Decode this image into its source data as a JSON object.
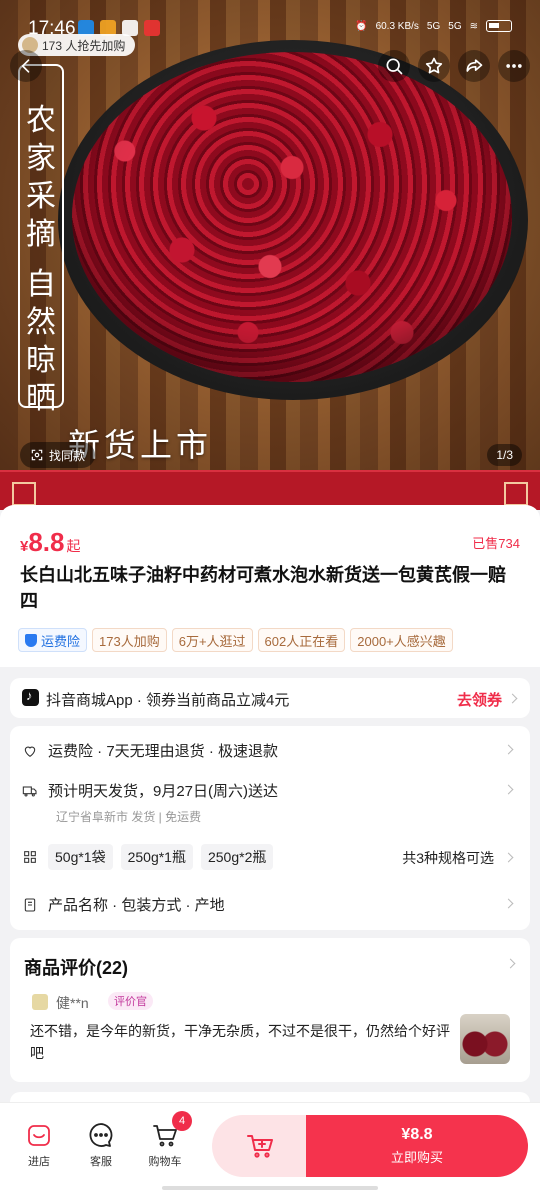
{
  "status_bar": {
    "time": "17:46",
    "network_speed": "60.3 KB/s",
    "signal_1": "5G",
    "signal_2": "5G"
  },
  "hero": {
    "buyers_text": "173 人抢先加购",
    "banner_line_1": [
      "农",
      "家",
      "采",
      "摘"
    ],
    "banner_line_2": [
      "自",
      "然",
      "晾",
      "晒"
    ],
    "overlay_text": "新货上市",
    "find_similar": "找同款",
    "page_indicator": "1/3"
  },
  "product": {
    "currency": "¥",
    "price": "8.8",
    "price_suffix": "起",
    "sold": "已售734",
    "title": "长白山北五味子油籽中药材可煮水泡水新货送一包黄芪假一赔四",
    "tags": [
      "运费险",
      "173人加购",
      "6万+人逛过",
      "602人正在看",
      "2000+人感兴趣"
    ]
  },
  "coupon": {
    "text": "抖音商城App · 领券当前商品立减4元",
    "action": "去领券"
  },
  "info": {
    "service": "运费险 · 7天无理由退货 · 极速退款",
    "shipping": "预计明天发货，9月27日(周六)送达",
    "shipping_sub": "辽宁省阜新市 发货 | 免运费",
    "specs": [
      "50g*1袋",
      "250g*1瓶",
      "250g*2瓶"
    ],
    "specs_more": "共3种规格可选",
    "params": "产品名称 · 包装方式 · 产地"
  },
  "reviews": {
    "title": "商品评价(22)",
    "user": "健**n",
    "badge": "评价官",
    "text": "还不错，是今年的新货，干净无杂质，不过不是很干，仍然给个好评吧"
  },
  "bottom_bar": {
    "shop": "进店",
    "service": "客服",
    "cart": "购物车",
    "cart_count": "4",
    "buy_price": "¥8.8",
    "buy_label": "立即购买"
  },
  "colors": {
    "accent": "#f02d4a",
    "buy_button": "#f5334d",
    "add_cart_bg": "#fde3e6"
  }
}
